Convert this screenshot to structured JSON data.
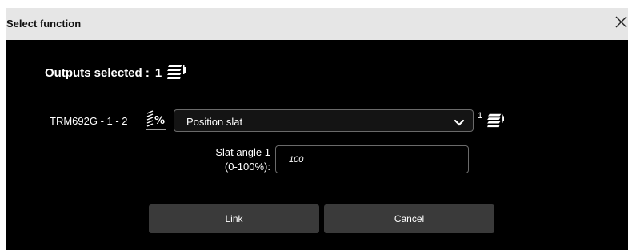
{
  "dialog": {
    "title": "Select function",
    "close_icon": "close-icon"
  },
  "outputs": {
    "label": "Outputs selected :",
    "count": "1",
    "icon": "outputs-stack-icon"
  },
  "device": {
    "label": "TRM692G - 1 - 2",
    "icon": "slat-position-icon"
  },
  "function_select": {
    "value": "Position slat",
    "icon": "chevron-down-icon"
  },
  "function_output": {
    "count": "1",
    "icon": "outputs-stack-icon"
  },
  "parameter": {
    "label_line1": "Slat angle 1",
    "label_line2": "(0-100%):",
    "value": "100"
  },
  "buttons": {
    "link": "Link",
    "cancel": "Cancel"
  },
  "colors": {
    "dialog_background": "#000000",
    "titlebar": "#e6e6e6",
    "button": "#3a3a3a",
    "field_border": "#6a6a6a"
  }
}
